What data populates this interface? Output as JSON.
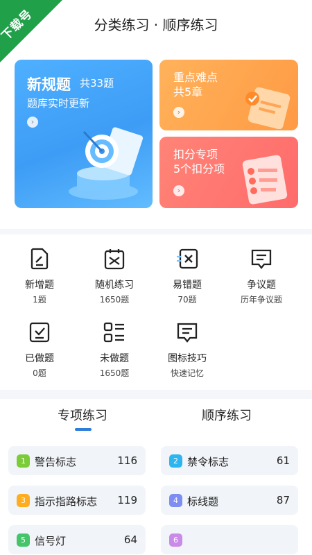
{
  "watermark": "下载号",
  "header": {
    "title": "分类练习 · 顺序练习"
  },
  "cards": {
    "new": {
      "title": "新规题",
      "count": "共33题",
      "sub": "题库实时更新"
    },
    "key": {
      "title": "重点难点",
      "sub": "共5章"
    },
    "deduct": {
      "title": "扣分专项",
      "sub": "5个扣分项"
    }
  },
  "grid": [
    {
      "label": "新增题",
      "sub": "1题",
      "icon": "new-question-icon"
    },
    {
      "label": "随机练习",
      "sub": "1650题",
      "icon": "shuffle-icon"
    },
    {
      "label": "易错题",
      "sub": "70题",
      "icon": "error-icon"
    },
    {
      "label": "争议题",
      "sub": "历年争议题",
      "icon": "dispute-icon"
    },
    {
      "label": "已做题",
      "sub": "0题",
      "icon": "done-icon"
    },
    {
      "label": "未做题",
      "sub": "1650题",
      "icon": "undone-icon"
    },
    {
      "label": "图标技巧",
      "sub": "快速记忆",
      "icon": "icon-tips-icon"
    }
  ],
  "tabs": {
    "special": "专项练习",
    "order": "顺序练习"
  },
  "items": [
    {
      "num": "1",
      "name": "警告标志",
      "count": "116",
      "color": "#7ccc3a"
    },
    {
      "num": "2",
      "name": "禁令标志",
      "count": "61",
      "color": "#2db5f0"
    },
    {
      "num": "3",
      "name": "指示指路标志",
      "count": "119",
      "color": "#ffad1f"
    },
    {
      "num": "4",
      "name": "标线题",
      "count": "87",
      "color": "#7d8df2"
    },
    {
      "num": "5",
      "name": "信号灯",
      "count": "64",
      "color": "#45c46a"
    },
    {
      "num": "6",
      "name": "",
      "count": "",
      "color": "#c98ae8"
    }
  ]
}
